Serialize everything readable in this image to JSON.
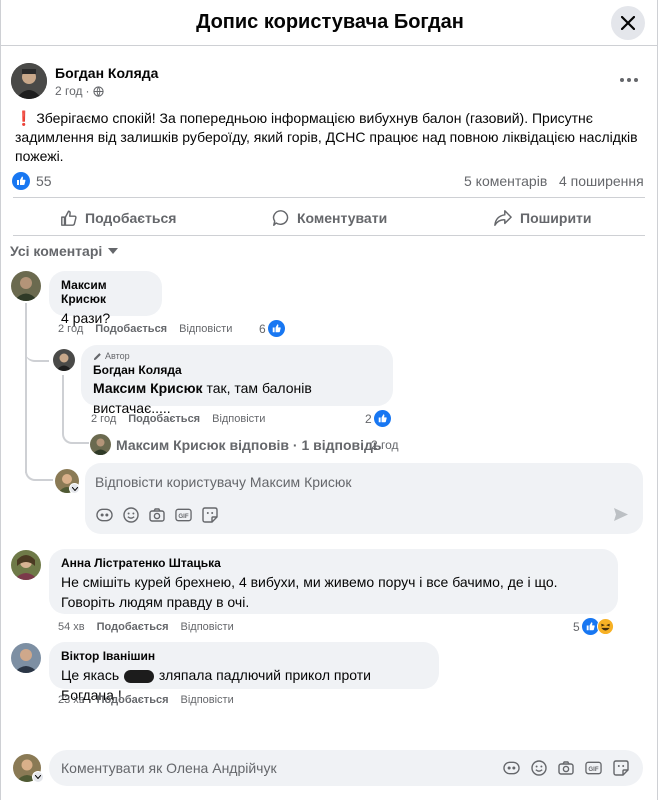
{
  "header": {
    "title": "Допис користувача Богдан"
  },
  "post": {
    "author": "Богдан Коляда",
    "time": "2 год",
    "text": "Зберігаємо спокій! За попередньою інформацією вибухнув балон (газовий). Присутнє задимлення від залишків руберoїду, який горів,  ДСНС працює над повною ліквідацією наслідків пожежі.",
    "likes": "55",
    "comments": "5 коментарів",
    "shares": "4 поширення"
  },
  "actions": {
    "like": "Подобається",
    "comment": "Коментувати",
    "share": "Поширити"
  },
  "filter": {
    "label": "Усі коментарі"
  },
  "comments": [
    {
      "name": "Максим Крисюк",
      "text": "4 рази?",
      "time": "2 год",
      "like": "Подобається",
      "reply": "Відповісти",
      "reactions": "6"
    },
    {
      "name": "Анна Лістратенко Штацька",
      "text": "Не смішіть курей брехнею, 4 вибухи, ми живемо поруч і все бачимо, де і що. Говоріть людям правду в очі.",
      "time": "54 хв",
      "like": "Подобається",
      "reply": "Відповісти",
      "reactions": "5"
    },
    {
      "name": "Віктор Іванішин",
      "text_before": "Це якась",
      "text_after": "зляпала падлючий прикол проти Богдана !",
      "time": "23 хв",
      "like": "Подобається",
      "reply": "Відповісти"
    }
  ],
  "reply": {
    "badge": "Автор",
    "name": "Богдан Коляда",
    "mention": "Максим Крисюк",
    "text": "так, там балонів вистачає.....",
    "time": "2 год",
    "like": "Подобається",
    "reply": "Відповісти",
    "reactions": "2"
  },
  "more_replies": {
    "name": "Максим Крисюк",
    "text": "відповів · 1 відповідь",
    "time": "2 год"
  },
  "reply_input": {
    "placeholder": "Відповісти користувачу Максим Крисюк"
  },
  "comment_input": {
    "placeholder": "Коментувати як Олена Андрійчук"
  },
  "colors": {
    "accent": "#1877f2",
    "secondary_text": "#65676b",
    "bubble": "#f0f2f5",
    "divider": "#ced0d4",
    "warning": "#e41e3f"
  },
  "icons": [
    "close-icon",
    "globe-icon",
    "more-icon",
    "like-icon",
    "comment-icon",
    "share-icon",
    "chevron-down-icon",
    "avatar-sticker-icon",
    "emoji-icon",
    "camera-icon",
    "gif-icon",
    "sticker-icon",
    "send-icon",
    "pencil-icon",
    "haha-icon"
  ]
}
